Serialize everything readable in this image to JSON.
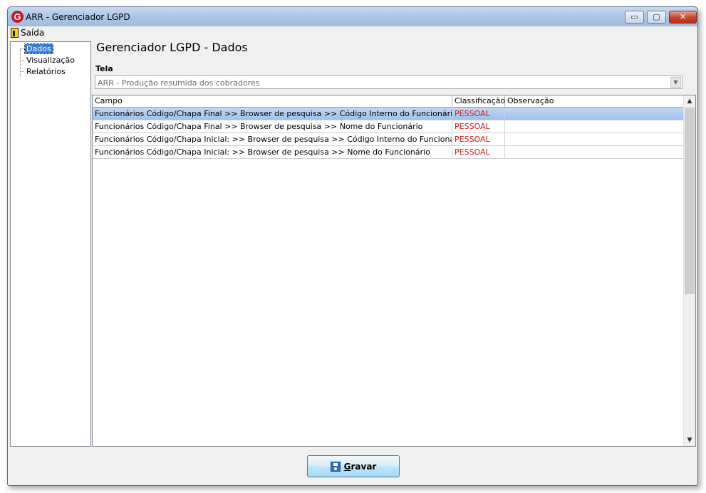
{
  "window": {
    "title": "ARR - Gerenciador LGPD",
    "app_icon_letter": "G",
    "controls": {
      "minimize": "▭",
      "maximize": "▢",
      "close": "✕"
    }
  },
  "menu": {
    "exit_label": "Saída"
  },
  "sidebar": {
    "items": [
      {
        "label": "Dados",
        "selected": true
      },
      {
        "label": "Visualização",
        "selected": false
      },
      {
        "label": "Relatórios",
        "selected": false
      }
    ]
  },
  "main": {
    "title": "Gerenciador LGPD - Dados",
    "tela_label": "Tela",
    "tela_value": "ARR - Produção resumida dos cobradores"
  },
  "grid": {
    "columns": [
      "Campo",
      "Classificação",
      "Observação"
    ],
    "rows": [
      {
        "campo": "Funcionários Código/Chapa Final >> Browser de pesquisa >> Código Interno do Funcionário",
        "classificacao": "PESSOAL",
        "observacao": "",
        "selected": true
      },
      {
        "campo": "Funcionários Código/Chapa Final >> Browser de pesquisa >> Nome do Funcionário",
        "classificacao": "PESSOAL",
        "observacao": "",
        "selected": false
      },
      {
        "campo": "Funcionários Código/Chapa Inicial: >> Browser de pesquisa >> Código Interno do Funcionário",
        "classificacao": "PESSOAL",
        "observacao": "",
        "selected": false
      },
      {
        "campo": "Funcionários Código/Chapa Inicial: >> Browser de pesquisa >> Nome do Funcionário",
        "classificacao": "PESSOAL",
        "observacao": "",
        "selected": false
      }
    ]
  },
  "footer": {
    "save_label": "Gravar"
  },
  "colors": {
    "classification": "#d11a1a",
    "selection": "#3a7bd5",
    "title_bar": "#a9c3e4"
  }
}
